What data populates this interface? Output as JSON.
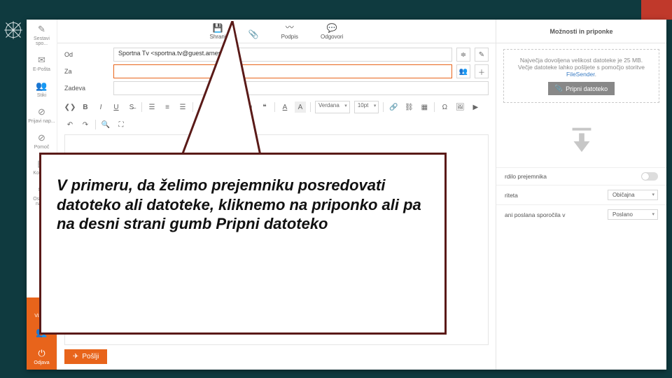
{
  "slide": {
    "callout_text": "V primeru, da želimo prejemniku posredovati datoteko ali datoteke, kliknemo na priponko ali pa na desni strani gumb Pripni datoteko"
  },
  "sidebar": {
    "items": [
      {
        "label": "Sestavi spo...",
        "icon": "✎"
      },
      {
        "label": "E-Pošta",
        "icon": "✉"
      },
      {
        "label": "Stiki",
        "icon": "👥"
      },
      {
        "label": "Prijavi nap...",
        "icon": "⊘"
      },
      {
        "label": "Pomoč",
        "icon": "⊘"
      },
      {
        "label": "Koledar",
        "icon": "▦"
      },
      {
        "label": "Osebne nas...",
        "icon": "⚙"
      }
    ],
    "bottom": [
      {
        "label": "Vizitka",
        "icon": "?"
      },
      {
        "label": "",
        "icon": "👥"
      },
      {
        "label": "Odjava",
        "icon": "⏻"
      }
    ]
  },
  "tabs": {
    "items": [
      {
        "label": "Shrani",
        "icon": "💾"
      },
      {
        "label": "",
        "icon": "📎"
      },
      {
        "label": "Podpis",
        "icon": "〰"
      },
      {
        "label": "Odgovori",
        "icon": "💬"
      }
    ]
  },
  "compose": {
    "from_label": "Od",
    "from_value": "Sportna Tv <sportna.tv@guest.arnes.si>",
    "to_label": "Za",
    "to_value": "",
    "subject_label": "Zadeva",
    "subject_value": "",
    "font_family": "Verdana",
    "font_size": "10pt",
    "send_label": "Pošlji"
  },
  "right": {
    "title": "Možnosti in priponke",
    "attach_hint_1": "Največja dovoljena velikost datoteke je 25 MB.",
    "attach_hint_2a": "Večje datoteke lahko pošljete s pomočjo storitve ",
    "attach_hint_link": "FileSender",
    "attach_hint_2b": ".",
    "attach_btn": "Pripni datoteko",
    "opt_receipt": "rdilo prejemnika",
    "opt_priority_label": "riteta",
    "opt_priority_value": "Običajna",
    "opt_save_label": "ani poslana sporočila v",
    "opt_save_value": "Poslano"
  }
}
